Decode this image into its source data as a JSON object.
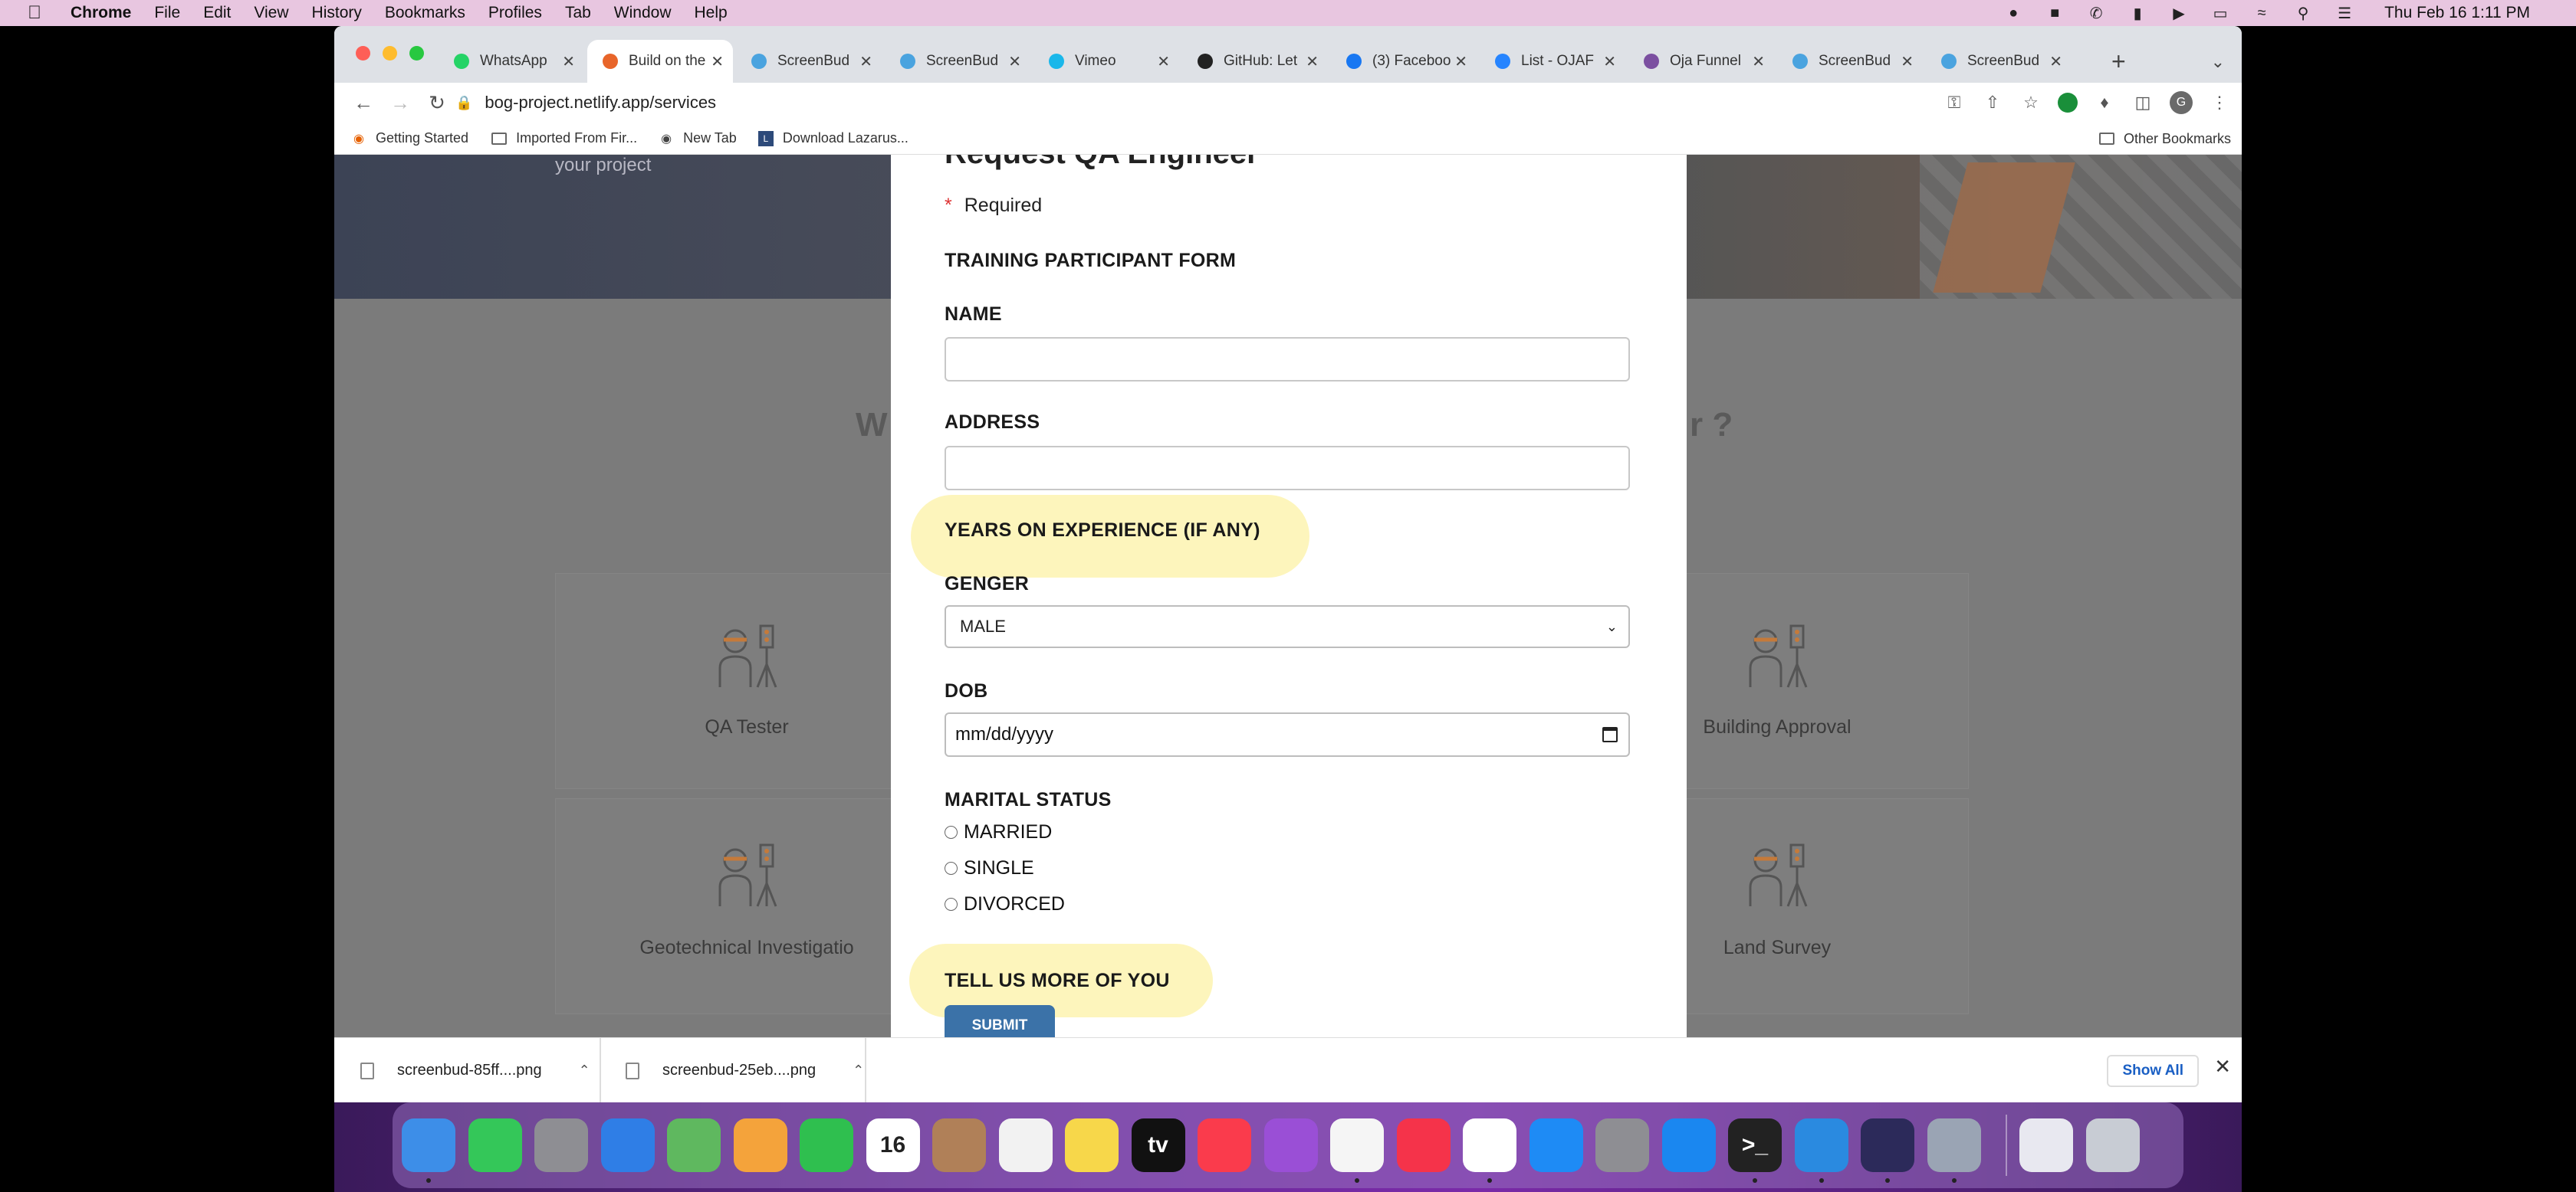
{
  "menubar": {
    "app_name": "Chrome",
    "menus": [
      "File",
      "Edit",
      "View",
      "History",
      "Bookmarks",
      "Profiles",
      "Tab",
      "Window",
      "Help"
    ],
    "clock": "Thu Feb 16  1:11 PM"
  },
  "tabs": [
    {
      "title": "WhatsApp",
      "icon": "whatsapp-icon",
      "color": "#25d366"
    },
    {
      "title": "Build on the",
      "icon": "site-icon",
      "color": "#e8652a",
      "active": true
    },
    {
      "title": "ScreenBud",
      "icon": "screenbud-icon",
      "color": "#4aa3df"
    },
    {
      "title": "ScreenBud",
      "icon": "screenbud-icon",
      "color": "#4aa3df"
    },
    {
      "title": "Vimeo",
      "icon": "vimeo-icon",
      "color": "#1ab7ea"
    },
    {
      "title": "GitHub: Let",
      "icon": "github-icon",
      "color": "#222222"
    },
    {
      "title": "(3) Faceboo",
      "icon": "facebook-icon",
      "color": "#1877f2"
    },
    {
      "title": "List - OJAF",
      "icon": "jira-icon",
      "color": "#2684ff"
    },
    {
      "title": "Oja Funnel",
      "icon": "oja-icon",
      "color": "#7b4fa0"
    },
    {
      "title": "ScreenBud",
      "icon": "screenbud-icon",
      "color": "#4aa3df"
    },
    {
      "title": "ScreenBud",
      "icon": "screenbud-icon",
      "color": "#4aa3df"
    }
  ],
  "address_bar": {
    "url": "bog-project.netlify.app/services"
  },
  "bookmarks": [
    {
      "label": "Getting Started",
      "icon": "firefox-icon"
    },
    {
      "label": "Imported From Fir...",
      "icon": "folder-icon"
    },
    {
      "label": "New Tab",
      "icon": "globe-icon"
    },
    {
      "label": "Download Lazarus...",
      "icon": "lazarus-icon"
    }
  ],
  "other_bookmarks": "Other Bookmarks",
  "hero": {
    "subtitle": "your project"
  },
  "section": {
    "title_left": "W",
    "title_right": "r ?"
  },
  "cards": [
    {
      "label": "QA Tester"
    },
    {
      "label": "Building Approval"
    },
    {
      "label": "Geotechnical Investigatio"
    },
    {
      "label": "Land Survey"
    }
  ],
  "modal": {
    "title": "Request QA Engineer",
    "required_mark": "*",
    "required_text": "Required",
    "form_title": "TRAINING PARTICIPANT FORM",
    "name_label": "NAME",
    "address_label": "ADDRESS",
    "experience_label": "YEARS ON EXPERIENCE (IF ANY)",
    "gender_label": "GENGER",
    "gender_value": "MALE",
    "dob_label": "DOB",
    "dob_placeholder": "mm/dd/yyyy",
    "marital_label": "MARITAL STATUS",
    "marital_options": [
      "MARRIED",
      "SINGLE",
      "DIVORCED"
    ],
    "more_label": "TELL US MORE OF YOU",
    "submit_label": "SUBMIT",
    "highlight_color": "#fdf4b8",
    "submit_color": "#3b72a8"
  },
  "downloads": {
    "items": [
      "screenbud-85ff....png",
      "screenbud-25eb....png"
    ],
    "show_all": "Show All"
  },
  "dock": {
    "apps": [
      {
        "name": "finder-icon",
        "color": "#3d8ee8",
        "running": true
      },
      {
        "name": "messages-icon",
        "color": "#34c759",
        "running": false
      },
      {
        "name": "launchpad-icon",
        "color": "#8e8e93",
        "running": false
      },
      {
        "name": "mail-icon",
        "color": "#2f7ee6",
        "running": false
      },
      {
        "name": "maps-icon",
        "color": "#5fb85f",
        "running": false
      },
      {
        "name": "photos-icon",
        "color": "#f4a33b",
        "running": false
      },
      {
        "name": "facetime-icon",
        "color": "#2fbf4f",
        "running": false
      },
      {
        "name": "calendar-icon",
        "color": "#ffffff",
        "running": false,
        "text": "16"
      },
      {
        "name": "contacts-icon",
        "color": "#b08058",
        "running": false
      },
      {
        "name": "reminders-icon",
        "color": "#f2f2f2",
        "running": false
      },
      {
        "name": "notes-icon",
        "color": "#f7d74a",
        "running": false
      },
      {
        "name": "apple-tv-icon",
        "color": "#111111",
        "running": false,
        "text": "tv"
      },
      {
        "name": "music-icon",
        "color": "#fa3b4c",
        "running": false
      },
      {
        "name": "podcasts-icon",
        "color": "#9a4fd6",
        "running": false
      },
      {
        "name": "textedit-icon",
        "color": "#f5f5f5",
        "running": true
      },
      {
        "name": "news-icon",
        "color": "#f5334a",
        "running": false
      },
      {
        "name": "chrome-icon",
        "color": "#ffffff",
        "running": true
      },
      {
        "name": "app-store-icon",
        "color": "#1e8bf5",
        "running": false
      },
      {
        "name": "system-preferences-icon",
        "color": "#8e8e93",
        "running": false
      },
      {
        "name": "safari-icon",
        "color": "#1a87f0",
        "running": false
      },
      {
        "name": "terminal-icon",
        "color": "#222222",
        "running": true,
        "text": ">_"
      },
      {
        "name": "xcode-icon",
        "color": "#2a8ae0",
        "running": true
      },
      {
        "name": "eclipse-icon",
        "color": "#2c2a5a",
        "running": true
      },
      {
        "name": "preview-icon",
        "color": "#9aa4b4",
        "running": true
      }
    ],
    "tray": [
      {
        "name": "screenshot-thumbnail-icon",
        "color": "#e8e8f0"
      },
      {
        "name": "trash-icon",
        "color": "#c8ccd4"
      }
    ]
  }
}
